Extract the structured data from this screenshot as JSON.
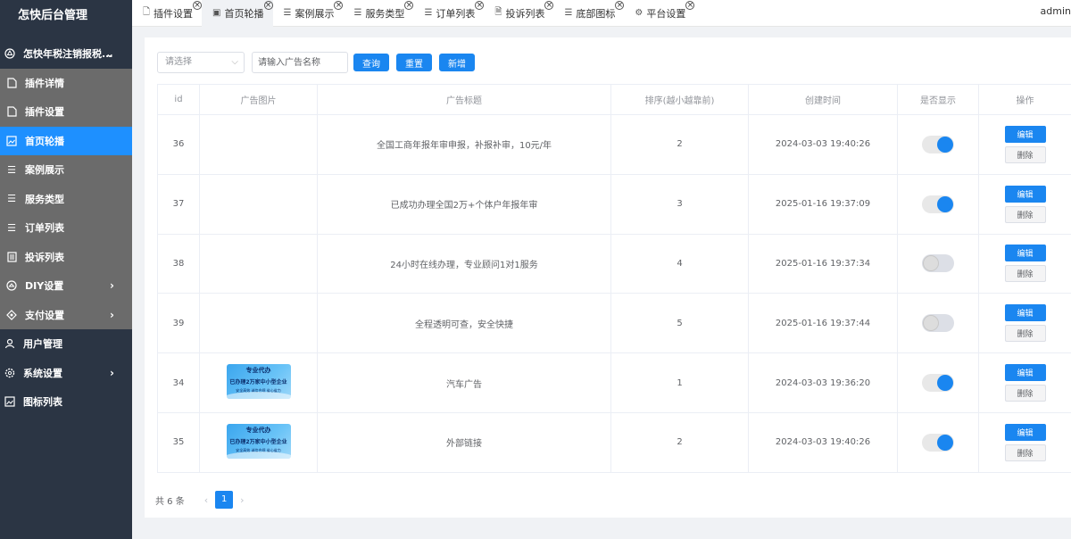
{
  "sidebar": {
    "brand": "怎快后台管理",
    "top_group": {
      "label": "怎快年税注销报税...",
      "icon": "app-icon"
    },
    "sub_items": [
      {
        "label": "插件详情",
        "icon": "file-icon",
        "active": false
      },
      {
        "label": "插件设置",
        "icon": "file-icon",
        "active": false
      },
      {
        "label": "首页轮播",
        "icon": "image-icon",
        "active": true
      },
      {
        "label": "案例展示",
        "icon": "list-icon",
        "active": false
      },
      {
        "label": "服务类型",
        "icon": "list-icon",
        "active": false
      },
      {
        "label": "订单列表",
        "icon": "list-icon",
        "active": false
      },
      {
        "label": "投诉列表",
        "icon": "document-icon",
        "active": false
      },
      {
        "label": "DIY设置",
        "icon": "diy-icon",
        "active": false
      },
      {
        "label": "支付设置",
        "icon": "payment-icon",
        "active": false
      }
    ],
    "bottom_items": [
      {
        "label": "用户管理",
        "icon": "user-icon"
      },
      {
        "label": "系统设置",
        "icon": "gear-icon"
      },
      {
        "label": "图标列表",
        "icon": "image-icon"
      }
    ]
  },
  "tabs": [
    {
      "label": "插件设置",
      "icon": "file-icon"
    },
    {
      "label": "首页轮播",
      "icon": "image-icon",
      "active": true
    },
    {
      "label": "案例展示",
      "icon": "list-icon"
    },
    {
      "label": "服务类型",
      "icon": "list-icon"
    },
    {
      "label": "订单列表",
      "icon": "list-icon"
    },
    {
      "label": "投诉列表",
      "icon": "document-icon"
    },
    {
      "label": "底部图标",
      "icon": "list-icon"
    },
    {
      "label": "平台设置",
      "icon": "gear-icon"
    }
  ],
  "user": {
    "name": "admin"
  },
  "filters": {
    "select_value": "请选择",
    "search_placeholder": "请输入广告名称",
    "query_label": "查询",
    "reset_label": "重置",
    "add_label": "新增"
  },
  "table": {
    "headers": [
      "id",
      "广告图片",
      "广告标题",
      "排序(越小越靠前)",
      "创建时间",
      "是否显示",
      "操作"
    ],
    "edit_label": "编辑",
    "delete_label": "删除",
    "rows": [
      {
        "id": "36",
        "has_image": false,
        "title": "全国工商年报年审申报，补报补审，10元/年",
        "sort": "2",
        "created": "2024-03-03 19:40:26",
        "show": true
      },
      {
        "id": "37",
        "has_image": false,
        "title": "已成功办理全国2万+个体户年报年审",
        "sort": "3",
        "created": "2025-01-16 19:37:09",
        "show": true
      },
      {
        "id": "38",
        "has_image": false,
        "title": "24小时在线办理，专业顾问1对1服务",
        "sort": "4",
        "created": "2025-01-16 19:37:34",
        "show": false
      },
      {
        "id": "39",
        "has_image": false,
        "title": "全程透明可查，安全快捷",
        "sort": "5",
        "created": "2025-01-16 19:37:44",
        "show": false
      },
      {
        "id": "34",
        "has_image": true,
        "title": "汽车广告",
        "sort": "1",
        "created": "2024-03-03 19:36:20",
        "show": true
      },
      {
        "id": "35",
        "has_image": true,
        "title": "外部链接",
        "sort": "2",
        "created": "2024-03-03 19:40:26",
        "show": true
      }
    ]
  },
  "ad_image": {
    "line1": "专业代办",
    "line2": "已办理2万家中小型企业",
    "line3": "安全高效 诚信合规 省心省力"
  },
  "pagination": {
    "total_text": "共 6 条",
    "current_page": "1"
  },
  "colors": {
    "primary": "#1a86f0",
    "sidebar": "#2b3544",
    "submenu": "#6b6b6b"
  }
}
